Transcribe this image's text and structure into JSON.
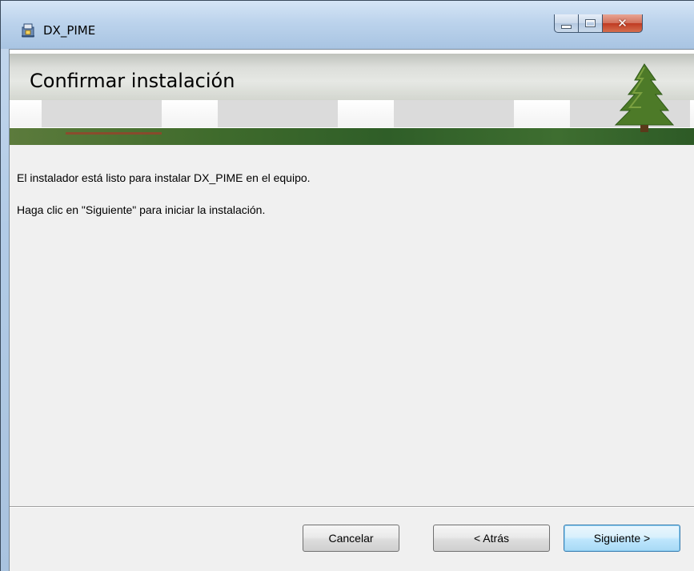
{
  "window": {
    "title": "DX_PIME",
    "controls": {
      "minimize": "minimize-icon",
      "maximize": "maximize-icon",
      "close": "✕"
    }
  },
  "banner": {
    "title": "Confirmar instalación",
    "logo_icon": "pine-tree-icon"
  },
  "content": {
    "line1": "El instalador está listo para instalar DX_PIME en el equipo.",
    "line2": "Haga clic en \"Siguiente\" para iniciar la instalación."
  },
  "buttons": {
    "cancel": "Cancelar",
    "back": "< Atrás",
    "next": "Siguiente >"
  },
  "colors": {
    "titlebar": "#bcd3ec",
    "close_button": "#c4442c",
    "banner_strip": "#3f6b2c",
    "default_button_border": "#3c7fb1"
  }
}
